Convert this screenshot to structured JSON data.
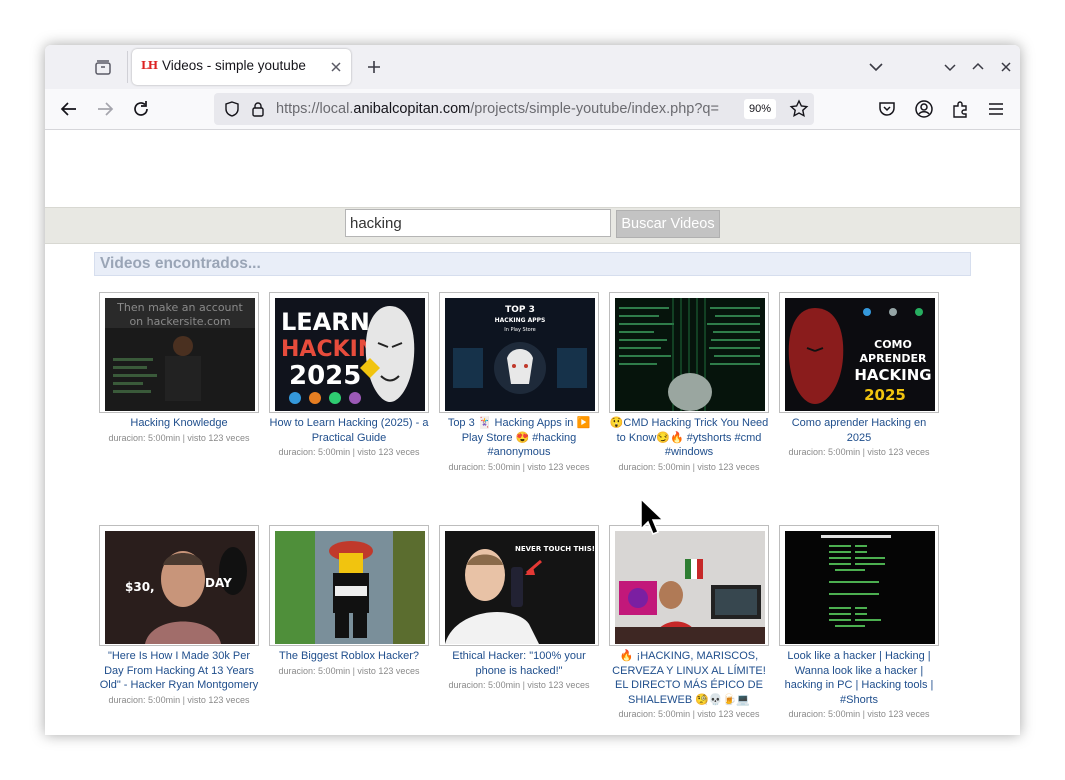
{
  "browser": {
    "tab": {
      "favicon_text": "LH",
      "title": "Videos - simple youtube"
    },
    "url": {
      "prefix": "https://local.",
      "domain": "anibalcopitan.com",
      "path": "/projects/simple-youtube/index.php?q="
    },
    "zoom": "90%"
  },
  "search": {
    "value": "hacking",
    "button_label": "Buscar Videos"
  },
  "results_heading": "Videos encontrados...",
  "videos": [
    {
      "title": "Hacking Knowledge",
      "meta": "duracion: 5:00min | visto 123 veces",
      "thumb_caption": "Then make an account on hackersite.com"
    },
    {
      "title": "How to Learn Hacking (2025) - a Practical Guide",
      "meta": "duracion: 5:00min | visto 123 veces",
      "thumb_caption": "LEARN HACKING 2025"
    },
    {
      "title": "Top 3 🃏 Hacking Apps in ▶️ Play Store 😍 #hacking #anonymous",
      "meta": "duracion: 5:00min | visto 123 veces",
      "thumb_caption": "TOP 3 HACKING APPS In Play Store"
    },
    {
      "title": "😲CMD Hacking Trick You Need to Know😏🔥 #ytshorts #cmd #windows",
      "meta": "duracion: 5:00min | visto 123 veces",
      "thumb_caption": ""
    },
    {
      "title": "Como aprender Hacking en 2025",
      "meta": "duracion: 5:00min | visto 123 veces",
      "thumb_caption": "COMO APRENDER HACKING 2025"
    },
    {
      "title": "\"Here Is How I Made 30k Per Day From Hacking At 13 Years Old\" - Hacker Ryan Montgomery",
      "meta": "duracion: 5:00min | visto 123 veces",
      "thumb_caption": "$30, DAY"
    },
    {
      "title": "The Biggest Roblox Hacker?",
      "meta": "duracion: 5:00min | visto 123 veces",
      "thumb_caption": ""
    },
    {
      "title": "Ethical Hacker: \"100% your phone is hacked!\"",
      "meta": "duracion: 5:00min | visto 123 veces",
      "thumb_caption": "NEVER TOUCH THIS!"
    },
    {
      "title": "🔥 ¡HACKING, MARISCOS, CERVEZA Y LINUX AL LÍMITE! EL DIRECTO MÁS ÉPICO DE SHIALEWEB 🧐💀🍺💻",
      "meta": "duracion: 5:00min | visto 123 veces",
      "thumb_caption": ""
    },
    {
      "title": "Look like a hacker | Hacking | Wanna look like a hacker | hacking in PC | Hacking tools | #Shorts",
      "meta": "duracion: 5:00min | visto 123 veces",
      "thumb_caption": ""
    }
  ],
  "colors": {
    "link": "#1f4e8c",
    "meta": "#8a8a8a",
    "heading_bg": "#e9eef8",
    "search_band": "#e8e8e3"
  }
}
